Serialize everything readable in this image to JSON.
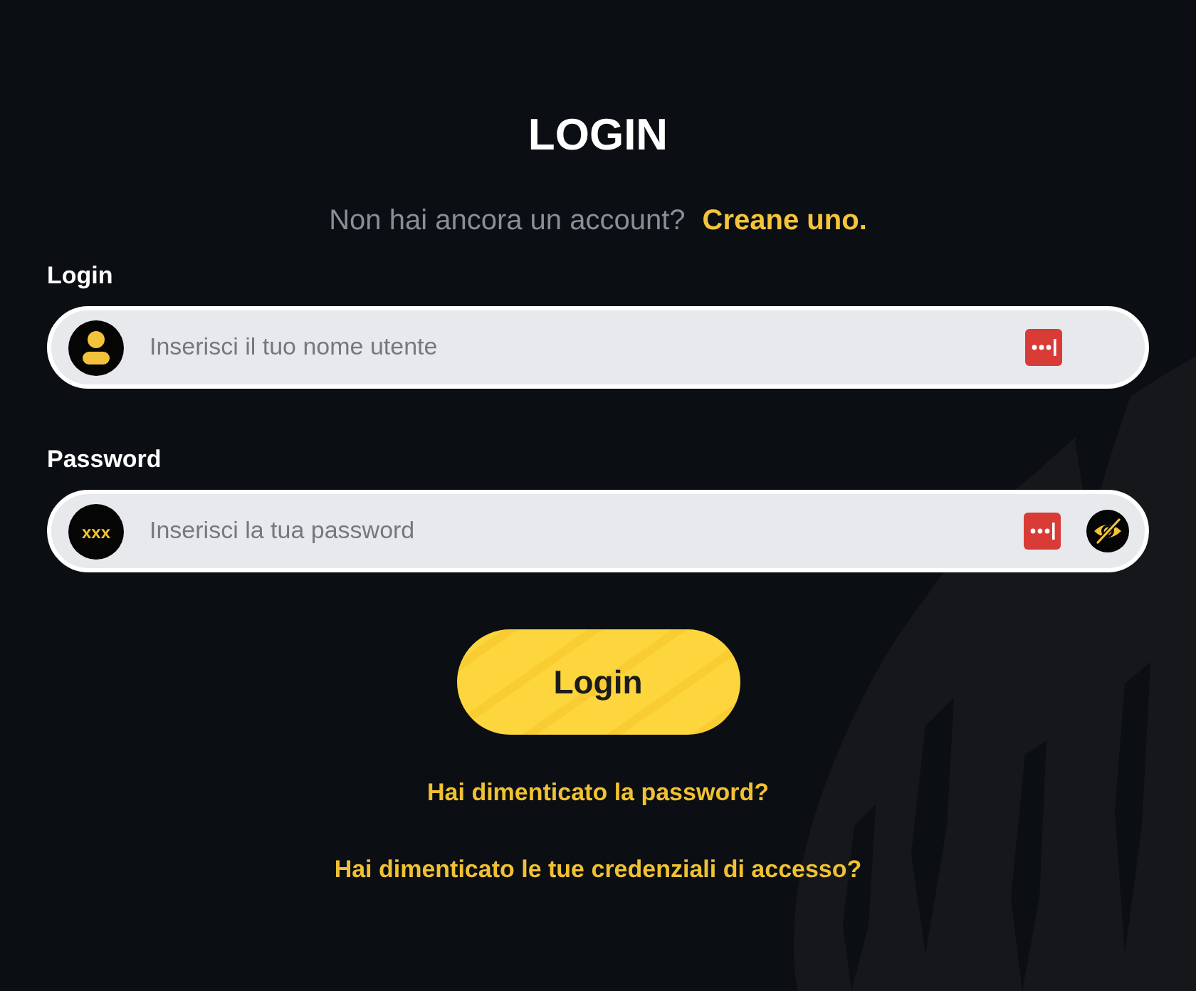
{
  "title": "LOGIN",
  "signup_prompt": {
    "text": "Non hai ancora un account?",
    "link": "Creane uno."
  },
  "fields": [
    {
      "kind": "username",
      "label": "Login",
      "placeholder": "Inserisci il tuo nome utente",
      "reveal_toggle": false
    },
    {
      "kind": "password",
      "label": "Password",
      "badge": "xxx",
      "placeholder": "Inserisci la tua password",
      "reveal_toggle": true
    }
  ],
  "submit_button": "Login",
  "links": [
    "Hai dimenticato la password?",
    "Hai dimenticato le tue credenziali di accesso?"
  ]
}
